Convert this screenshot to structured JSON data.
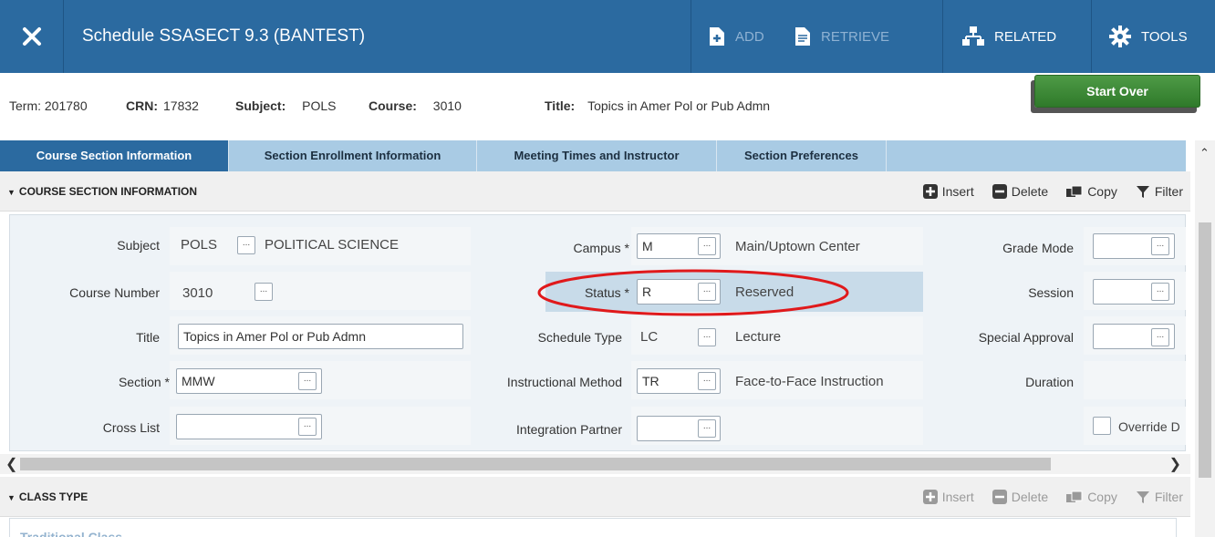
{
  "topbar": {
    "title": "Schedule SSASECT 9.3 (BANTEST)",
    "add_label": "ADD",
    "retrieve_label": "RETRIEVE",
    "related_label": "RELATED",
    "tools_label": "TOOLS"
  },
  "keyblock": {
    "term_label": "Term:",
    "term_value": "201780",
    "crn_label": "CRN:",
    "crn_value": "17832",
    "subject_label": "Subject:",
    "subject_value": "POLS",
    "course_label": "Course:",
    "course_value": "3010",
    "title_label": "Title:",
    "title_value": "Topics in Amer Pol or Pub Admn",
    "start_over": "Start Over"
  },
  "tabs": [
    {
      "label": "Course Section Information"
    },
    {
      "label": "Section Enrollment Information"
    },
    {
      "label": "Meeting Times and Instructor"
    },
    {
      "label": "Section Preferences"
    }
  ],
  "section1": {
    "title": "COURSE SECTION INFORMATION",
    "insert": "Insert",
    "delete": "Delete",
    "copy": "Copy",
    "filter": "Filter"
  },
  "form": {
    "subject_label": "Subject",
    "subject_code": "POLS",
    "subject_desc": "POLITICAL SCIENCE",
    "course_number_label": "Course Number",
    "course_number": "3010",
    "title_label": "Title",
    "title_value": "Topics in Amer Pol or Pub Admn",
    "section_label": "Section *",
    "section_value": "MMW",
    "cross_list_label": "Cross List",
    "campus_label": "Campus *",
    "campus_value": "M",
    "campus_desc": "Main/Uptown Center",
    "status_label": "Status *",
    "status_value": "R",
    "status_desc": "Reserved",
    "schedule_type_label": "Schedule Type",
    "schedule_type_value": "LC",
    "schedule_type_desc": "Lecture",
    "instructional_method_label": "Instructional Method",
    "instructional_method_value": "TR",
    "instructional_method_desc": "Face-to-Face Instruction",
    "integration_partner_label": "Integration Partner",
    "grade_mode_label": "Grade Mode",
    "session_label": "Session",
    "special_approval_label": "Special Approval",
    "duration_label": "Duration",
    "override_label": "Override D",
    "lov_glyph": "..."
  },
  "section2": {
    "title": "CLASS TYPE",
    "insert": "Insert",
    "delete": "Delete",
    "copy": "Copy",
    "filter": "Filter",
    "partial_text": "Traditional Class"
  },
  "colors": {
    "header_blue": "#2b6aa0",
    "tab_bar": "#a9cbe4",
    "start_over_green": "#3f8a38",
    "highlight_circle": "#e0191b"
  }
}
